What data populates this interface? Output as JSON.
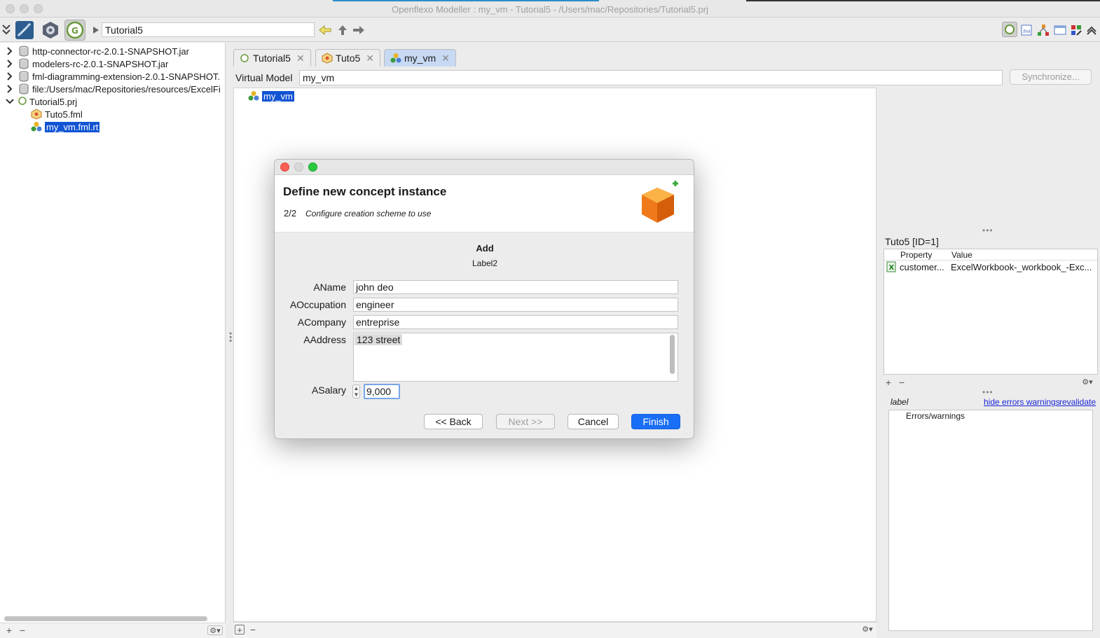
{
  "window": {
    "title": "Openflexo Modeller : my_vm - Tutorial5 - /Users/mac/Repositories/Tutorial5.prj"
  },
  "toolbar": {
    "path_value": "Tutorial5"
  },
  "tree": {
    "items": [
      {
        "label": "http-connector-rc-2.0.1-SNAPSHOT.jar"
      },
      {
        "label": "modelers-rc-2.0.1-SNAPSHOT.jar"
      },
      {
        "label": "fml-diagramming-extension-2.0.1-SNAPSHOT."
      },
      {
        "label": "file:/Users/mac/Repositories/resources/ExcelFi"
      },
      {
        "label": "Tutorial5.prj"
      },
      {
        "label": "Tuto5.fml"
      },
      {
        "label": "my_vm.fml.rt"
      }
    ]
  },
  "tabs": [
    {
      "label": "Tutorial5"
    },
    {
      "label": "Tuto5"
    },
    {
      "label": "my_vm"
    }
  ],
  "virtual_model": {
    "label": "Virtual Model",
    "value": "my_vm",
    "sync_button": "Synchronize...",
    "root_node": "my_vm"
  },
  "inspector": {
    "title": "Tuto5 [ID=1]",
    "col_property": "Property",
    "col_value": "Value",
    "rows": [
      {
        "property": "customer...",
        "value": "ExcelWorkbook-_workbook_-Exc..."
      }
    ],
    "label_text": "label",
    "hide_link": "hide errors warnings",
    "revalidate_link": "revalidate",
    "errors_header": "Errors/warnings"
  },
  "dialog": {
    "title": "Define new concept instance",
    "step": "2/2",
    "step_desc": "Configure creation scheme to use",
    "scheme_name": "Add",
    "scheme_label": "Label2",
    "fields": {
      "name_label": "AName",
      "name_value": "john deo",
      "occupation_label": "AOccupation",
      "occupation_value": "engineer",
      "company_label": "ACompany",
      "company_value": "entreprise",
      "address_label": "AAddress",
      "address_value": "123 street",
      "salary_label": "ASalary",
      "salary_value": "9,000"
    },
    "buttons": {
      "back": "<< Back",
      "next": "Next >>",
      "cancel": "Cancel",
      "finish": "Finish"
    }
  },
  "colors": {
    "selection": "#1254d4",
    "primary_button": "#1a6ef5",
    "link": "#1a26d6"
  }
}
